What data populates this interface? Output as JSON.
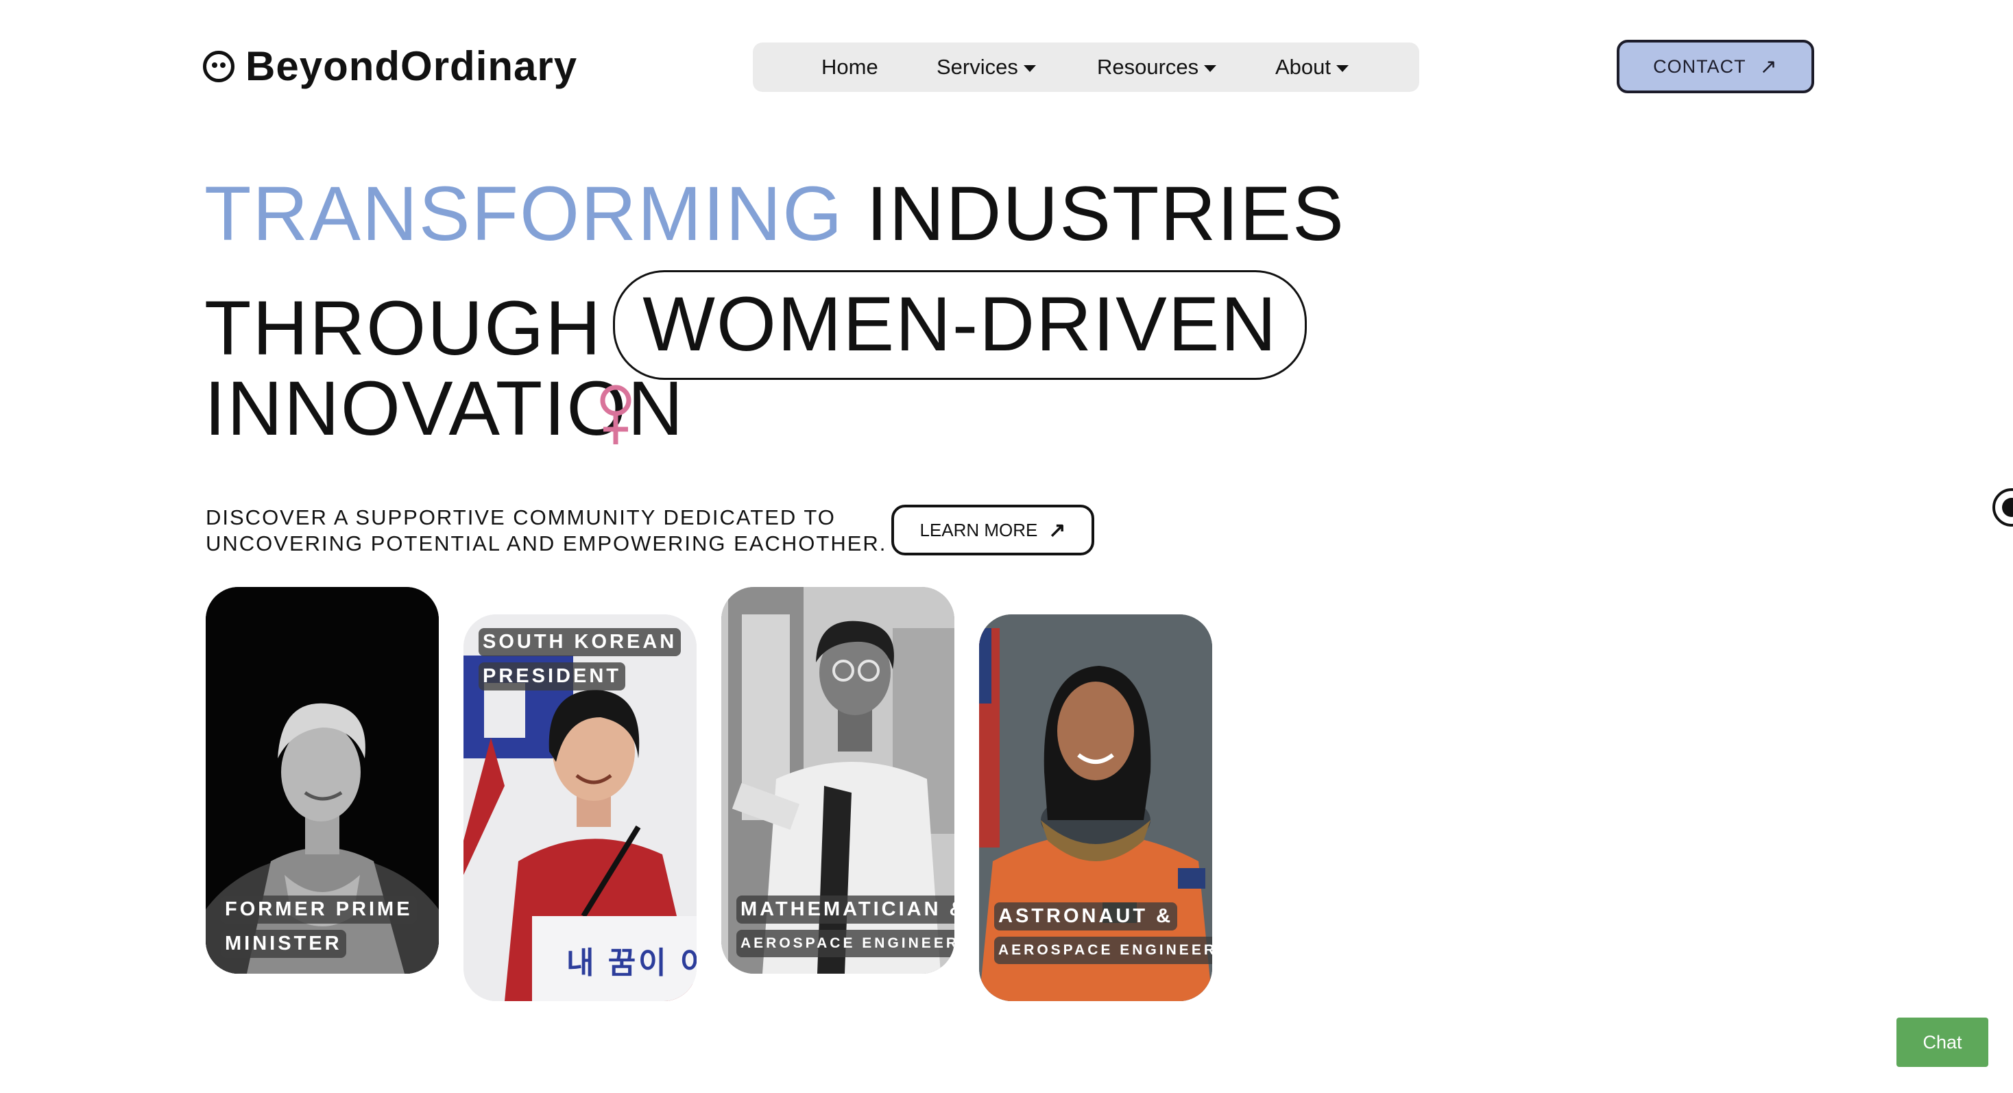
{
  "header": {
    "logo_text": "BeyondOrdinary",
    "logo_icon": "smiley-face-icon",
    "nav": [
      {
        "label": "Home",
        "has_dropdown": false
      },
      {
        "label": "Services",
        "has_dropdown": true
      },
      {
        "label": "Resources",
        "has_dropdown": true
      },
      {
        "label": "About",
        "has_dropdown": true
      }
    ],
    "contact_label": "CONTACT",
    "contact_icon": "arrow-up-right-icon"
  },
  "hero": {
    "line1_accent": "TRANSFORMING",
    "line1_rest": "INDUSTRIES",
    "line2_text": "THROUGH",
    "line2_pill": "WOMEN-DRIVEN",
    "line3_text": "INNOVATION",
    "symbol_icon": "female-sign-icon",
    "tagline_line1": "DISCOVER A SUPPORTIVE COMMUNITY DEDICATED TO",
    "tagline_line2": "UNCOVERING POTENTIAL AND EMPOWERING EACHOTHER.",
    "learn_more_label": "LEARN MORE",
    "learn_more_icon": "arrow-up-right-icon"
  },
  "cards": [
    {
      "tag_lines": [
        "FORMER PRIME",
        "MINISTER"
      ]
    },
    {
      "tag_lines": [
        "SOUTH KOREAN",
        "PRESIDENT"
      ],
      "sign_text": "내 꿈이 이"
    },
    {
      "tag_lines": [
        "MATHEMATICIAN &",
        "AEROSPACE ENGINEER"
      ]
    },
    {
      "tag_lines": [
        "ASTRONAUT &",
        "AEROSPACE ENGINEER"
      ]
    }
  ],
  "chat": {
    "label": "Chat"
  },
  "colors": {
    "accent_blue": "#83a1d6",
    "contact_bg": "#b3c2e6",
    "female_sign": "#d9739a",
    "chat_green": "#5ea85a",
    "nav_bg": "#ebebeb"
  }
}
